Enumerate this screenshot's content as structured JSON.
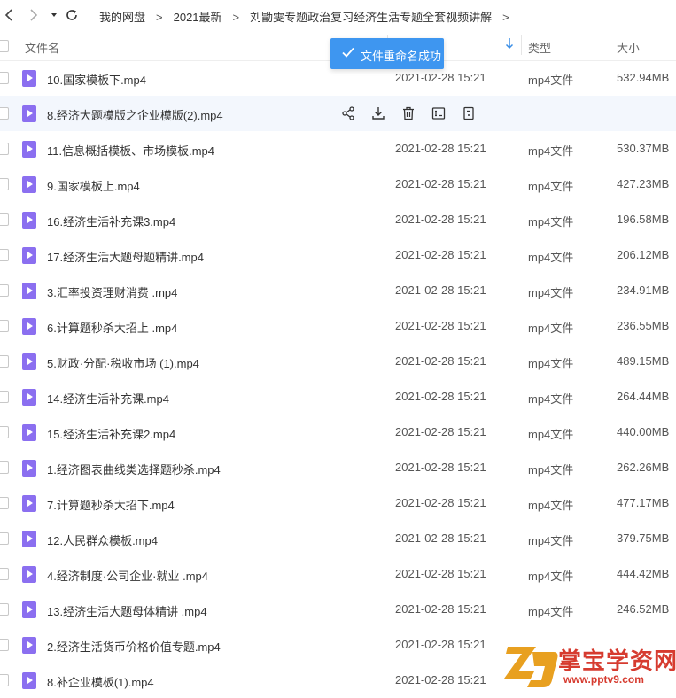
{
  "breadcrumb": {
    "items": [
      "我的网盘",
      "2021最新",
      "刘勖雯专题政治复习经济生活专题全套视频讲解"
    ],
    "separator": ">"
  },
  "nav": {
    "back_icon": "chevron-left-icon",
    "forward_icon": "chevron-right-icon",
    "history_icon": "dropdown-triangle-icon",
    "refresh_icon": "refresh-icon"
  },
  "table_header": {
    "name": "文件名",
    "type": "类型",
    "size": "大小"
  },
  "toast": {
    "message": "文件重命名成功",
    "color": "#3e96f0"
  },
  "files": [
    {
      "name": "10.国家模板下.mp4",
      "date": "2021-02-28 15:21",
      "type": "mp4文件",
      "size": "532.94MB"
    },
    {
      "name": "8.经济大题模版之企业模版(2).mp4",
      "date": "",
      "type": "",
      "size": "",
      "hover": true
    },
    {
      "name": "11.信息概括模板、市场模板.mp4",
      "date": "2021-02-28 15:21",
      "type": "mp4文件",
      "size": "530.37MB"
    },
    {
      "name": "9.国家模板上.mp4",
      "date": "2021-02-28 15:21",
      "type": "mp4文件",
      "size": "427.23MB"
    },
    {
      "name": "16.经济生活补充课3.mp4",
      "date": "2021-02-28 15:21",
      "type": "mp4文件",
      "size": "196.58MB"
    },
    {
      "name": "17.经济生活大题母题精讲.mp4",
      "date": "2021-02-28 15:21",
      "type": "mp4文件",
      "size": "206.12MB"
    },
    {
      "name": "3.汇率投资理财消费 .mp4",
      "date": "2021-02-28 15:21",
      "type": "mp4文件",
      "size": "234.91MB"
    },
    {
      "name": "6.计算题秒杀大招上 .mp4",
      "date": "2021-02-28 15:21",
      "type": "mp4文件",
      "size": "236.55MB"
    },
    {
      "name": "5.财政·分配·税收市场 (1).mp4",
      "date": "2021-02-28 15:21",
      "type": "mp4文件",
      "size": "489.15MB"
    },
    {
      "name": "14.经济生活补充课.mp4",
      "date": "2021-02-28 15:21",
      "type": "mp4文件",
      "size": "264.44MB"
    },
    {
      "name": "15.经济生活补充课2.mp4",
      "date": "2021-02-28 15:21",
      "type": "mp4文件",
      "size": "440.00MB"
    },
    {
      "name": "1.经济图表曲线类选择题秒杀.mp4",
      "date": "2021-02-28 15:21",
      "type": "mp4文件",
      "size": "262.26MB"
    },
    {
      "name": "7.计算题秒杀大招下.mp4",
      "date": "2021-02-28 15:21",
      "type": "mp4文件",
      "size": "477.17MB"
    },
    {
      "name": "12.人民群众模板.mp4",
      "date": "2021-02-28 15:21",
      "type": "mp4文件",
      "size": "379.75MB"
    },
    {
      "name": "4.经济制度·公司企业·就业 .mp4",
      "date": "2021-02-28 15:21",
      "type": "mp4文件",
      "size": "444.42MB"
    },
    {
      "name": "13.经济生活大题母体精讲 .mp4",
      "date": "2021-02-28 15:21",
      "type": "mp4文件",
      "size": "246.52MB"
    },
    {
      "name": "2.经济生活货币价格价值专题.mp4",
      "date": "2021-02-28 15:21",
      "type": "",
      "size": ""
    },
    {
      "name": "8.补企业模板(1).mp4",
      "date": "2021-02-28 15:21",
      "type": "",
      "size": ""
    }
  ],
  "row_actions": [
    "share-icon",
    "download-icon",
    "delete-icon",
    "rename-icon",
    "more-icon"
  ],
  "watermark": {
    "title": "掌宝学资网",
    "url": "www.pptv9.com",
    "color": "#d63b2f"
  }
}
